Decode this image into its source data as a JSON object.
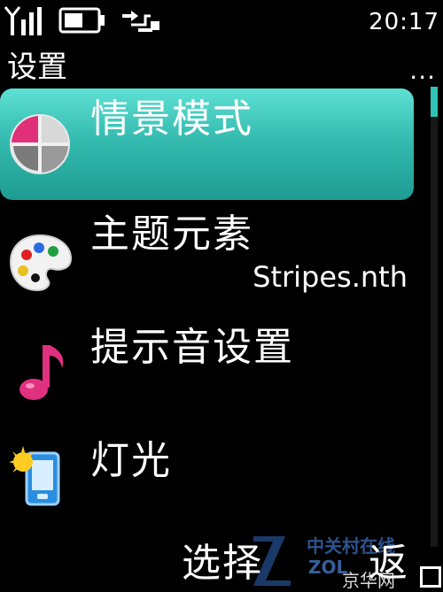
{
  "status": {
    "time": "20:17",
    "signal_icon": "signal-antenna-icon",
    "battery_icon": "battery-icon",
    "usb_icon": "usb-connection-icon"
  },
  "header": {
    "title": "设置",
    "options_glyph": "..."
  },
  "menu": {
    "items": [
      {
        "label": "情景模式",
        "icon": "profiles-icon",
        "selected": true
      },
      {
        "label": "主题元素",
        "icon": "palette-icon",
        "subtext": "Stripes.nth"
      },
      {
        "label": "提示音设置",
        "icon": "music-note-icon"
      },
      {
        "label": "灯光",
        "icon": "light-phone-icon"
      }
    ]
  },
  "softkeys": {
    "left": "选择",
    "right": "返"
  },
  "watermark": {
    "cn_name": "中关村在线",
    "brand_fragment": "ZOL",
    "corner_text": "京华网"
  },
  "colors": {
    "highlight": "#35bbb0",
    "background": "#000000",
    "scrollbar": "#2ec3b6"
  }
}
